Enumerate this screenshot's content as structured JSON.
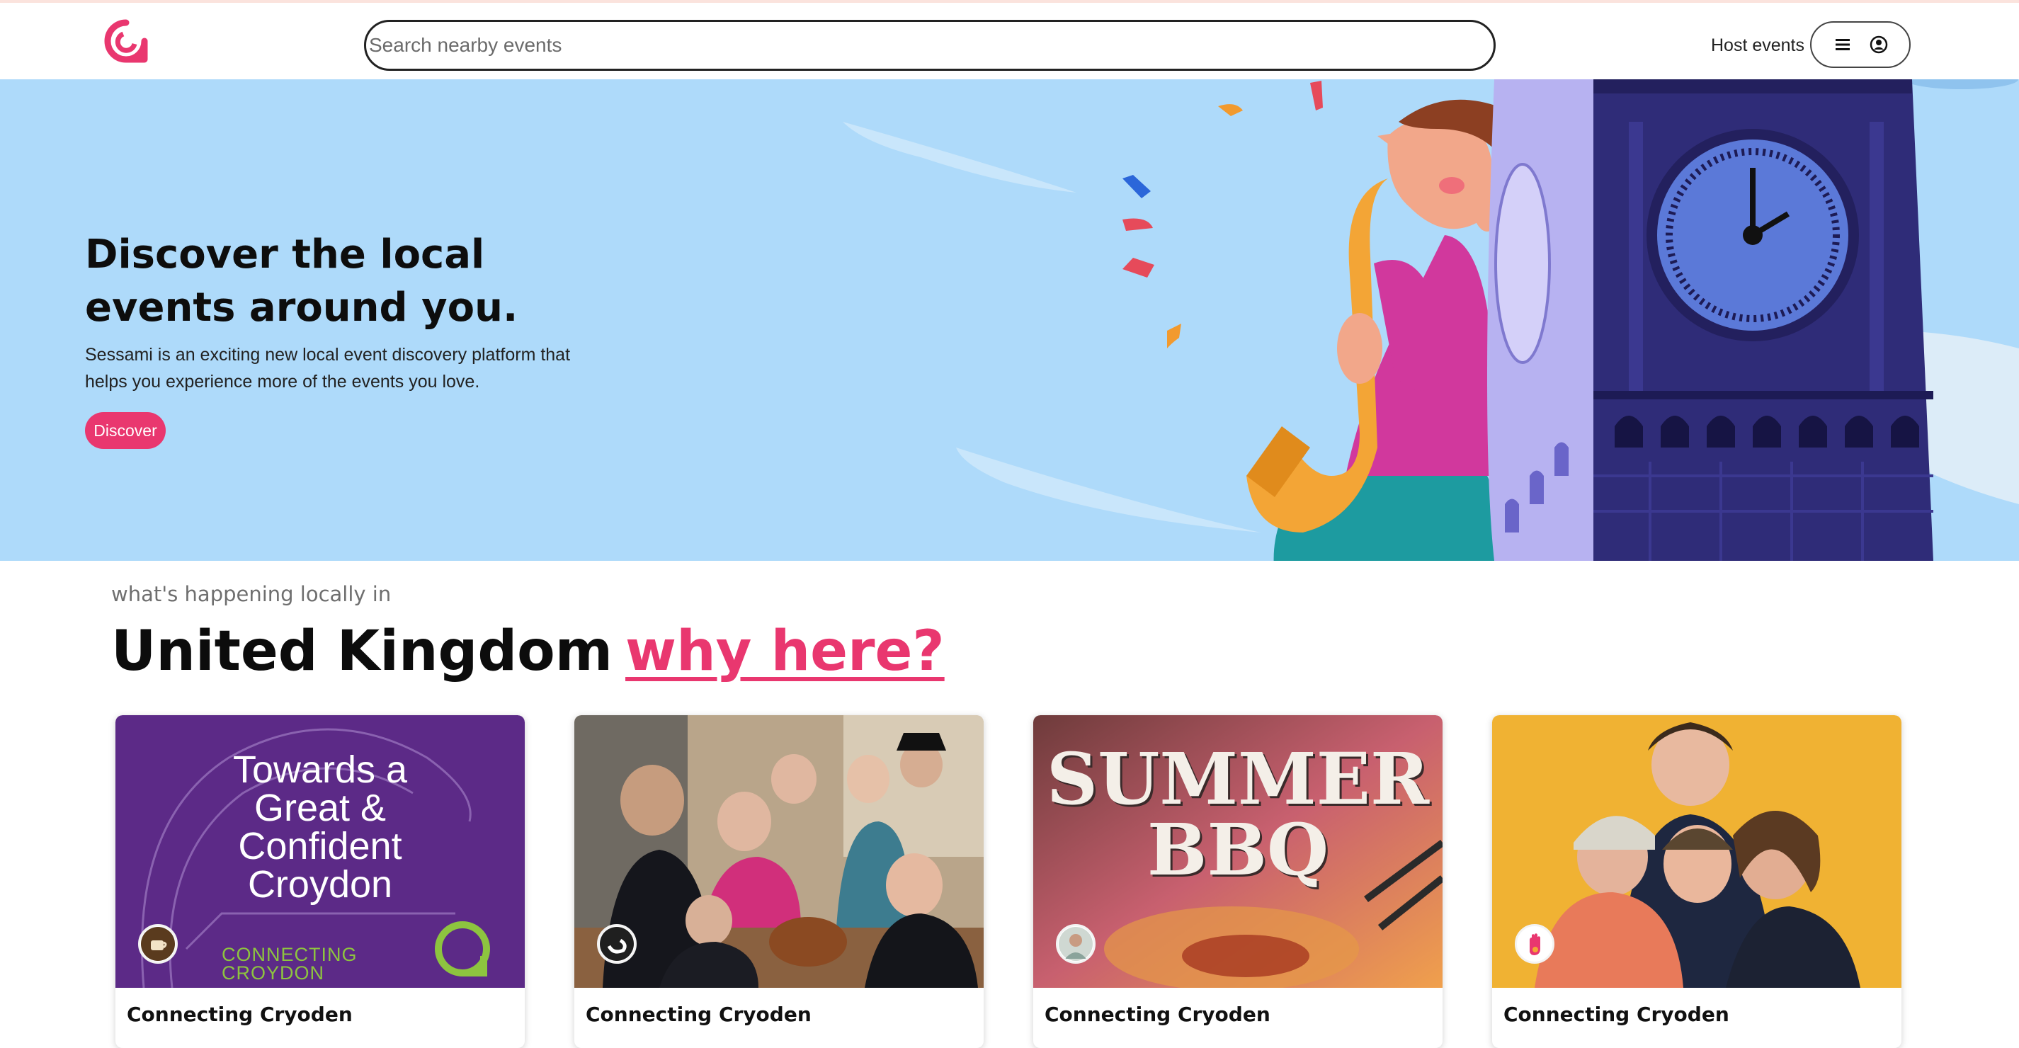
{
  "header": {
    "search_placeholder": "Search nearby events",
    "host_events_label": "Host events",
    "logo_icon": "sessami-logo-icon",
    "menu_icon": "hamburger-menu-icon",
    "account_icon": "user-circle-icon"
  },
  "hero": {
    "title": "Discover the local events around you.",
    "description": "Sessami is an exciting new local event discovery platform that helps you experience more of the events you love.",
    "discover_label": "Discover",
    "colors": {
      "background": "#aedafa",
      "accent": "#e9376f"
    }
  },
  "location": {
    "intro": "what's happening locally in",
    "place": "United Kingdom",
    "why_label": "why here?"
  },
  "events": [
    {
      "title": "Connecting Cryoden",
      "image_text_lines": [
        "Towards a",
        "Great &",
        "Confident",
        "Croydon"
      ],
      "brand_text_lines": [
        "CONNECTING",
        "CROYDON"
      ],
      "host_icon": "coffee-cup-badge-icon"
    },
    {
      "title": "Connecting Cryoden",
      "host_icon": "swirl-badge-icon"
    },
    {
      "title": "Connecting Cryoden",
      "image_text_lines": [
        "SUMMER",
        "BBQ"
      ],
      "host_icon": "person-avatar-icon"
    },
    {
      "title": "Connecting Cryoden",
      "host_icon": "hand-badge-icon"
    }
  ]
}
